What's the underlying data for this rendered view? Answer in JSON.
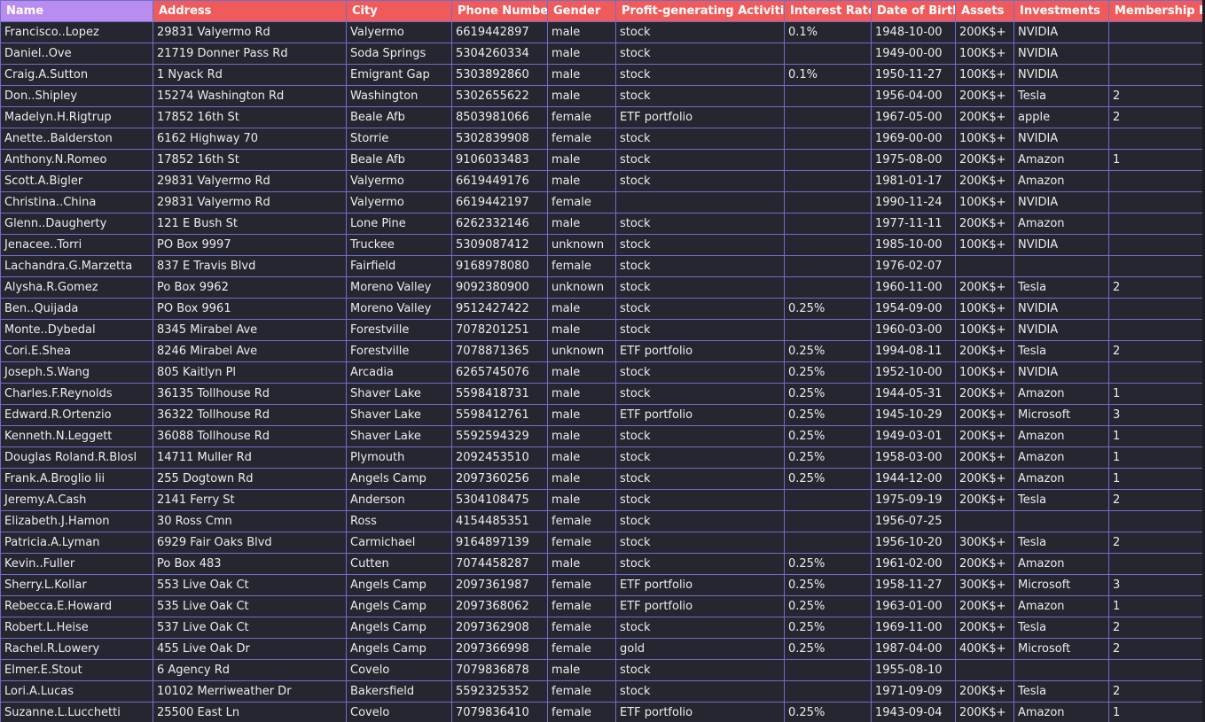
{
  "table": {
    "columns": [
      "Name",
      "Address",
      "City",
      "Phone Number",
      "Gender",
      "Profit-generating Activities",
      "Interest Rate",
      "Date of Birth",
      "Assets",
      "Investments",
      "Membership Pr"
    ],
    "rows": [
      [
        "Francisco..Lopez",
        "29831 Valyermo Rd",
        "Valyermo",
        "6619442897",
        "male",
        "stock",
        "0.1%",
        "1948-10-00",
        "200K$+",
        "NVIDIA",
        ""
      ],
      [
        "Daniel..Ove",
        "21719 Donner Pass Rd",
        "Soda Springs",
        "5304260334",
        "male",
        "stock",
        "",
        "1949-00-00",
        "100K$+",
        "NVIDIA",
        ""
      ],
      [
        "Craig.A.Sutton",
        "1 Nyack Rd",
        "Emigrant Gap",
        "5303892860",
        "male",
        "stock",
        "0.1%",
        "1950-11-27",
        "100K$+",
        "NVIDIA",
        ""
      ],
      [
        "Don..Shipley",
        "15274 Washington Rd",
        "Washington",
        "5302655622",
        "male",
        "stock",
        "",
        "1956-04-00",
        "200K$+",
        "Tesla",
        "2"
      ],
      [
        "Madelyn.H.Rigtrup",
        "17852 16th St",
        "Beale Afb",
        "8503981066",
        "female",
        "ETF portfolio",
        "",
        "1967-05-00",
        "200K$+",
        "apple",
        "2"
      ],
      [
        "Anette..Balderston",
        "6162 Highway 70",
        "Storrie",
        "5302839908",
        "female",
        "stock",
        "",
        "1969-00-00",
        "100K$+",
        "NVIDIA",
        ""
      ],
      [
        "Anthony.N.Romeo",
        "17852 16th St",
        "Beale Afb",
        "9106033483",
        "male",
        "stock",
        "",
        "1975-08-00",
        "200K$+",
        "Amazon",
        "1"
      ],
      [
        "Scott.A.Bigler",
        "29831 Valyermo Rd",
        "Valyermo",
        "6619449176",
        "male",
        "stock",
        "",
        "1981-01-17",
        "200K$+",
        "Amazon",
        ""
      ],
      [
        "Christina..China",
        "29831 Valyermo Rd",
        "Valyermo",
        "6619442197",
        "female",
        "",
        "",
        "1990-11-24",
        "100K$+",
        "NVIDIA",
        ""
      ],
      [
        "Glenn..Daugherty",
        "121 E Bush St",
        "Lone Pine",
        "6262332146",
        "male",
        "stock",
        "",
        "1977-11-11",
        "200K$+",
        "Amazon",
        ""
      ],
      [
        "Jenacee..Torri",
        "PO Box 9997",
        "Truckee",
        "5309087412",
        "unknown",
        "stock",
        "",
        "1985-10-00",
        "100K$+",
        "NVIDIA",
        ""
      ],
      [
        "Lachandra.G.Marzetta",
        "837 E Travis Blvd",
        "Fairfield",
        "9168978080",
        "female",
        "stock",
        "",
        "1976-02-07",
        "",
        "",
        ""
      ],
      [
        "Alysha.R.Gomez",
        "Po Box 9962",
        "Moreno Valley",
        "9092380900",
        "unknown",
        "stock",
        "",
        "1960-11-00",
        "200K$+",
        "Tesla",
        "2"
      ],
      [
        "Ben..Quijada",
        "PO Box 9961",
        "Moreno Valley",
        "9512427422",
        "male",
        "stock",
        "0.25%",
        "1954-09-00",
        "100K$+",
        "NVIDIA",
        ""
      ],
      [
        "Monte..Dybedal",
        "8345 Mirabel Ave",
        "Forestville",
        "7078201251",
        "male",
        "stock",
        "",
        "1960-03-00",
        "100K$+",
        "NVIDIA",
        ""
      ],
      [
        "Cori.E.Shea",
        "8246 Mirabel Ave",
        "Forestville",
        "7078871365",
        "unknown",
        "ETF portfolio",
        "0.25%",
        "1994-08-11",
        "200K$+",
        "Tesla",
        "2"
      ],
      [
        "Joseph.S.Wang",
        "805 Kaitlyn Pl",
        "Arcadia",
        "6265745076",
        "male",
        "stock",
        "0.25%",
        "1952-10-00",
        "100K$+",
        "NVIDIA",
        ""
      ],
      [
        "Charles.F.Reynolds",
        "36135 Tollhouse Rd",
        "Shaver Lake",
        "5598418731",
        "male",
        "stock",
        "0.25%",
        "1944-05-31",
        "200K$+",
        "Amazon",
        "1"
      ],
      [
        "Edward.R.Ortenzio",
        "36322 Tollhouse Rd",
        "Shaver Lake",
        "5598412761",
        "male",
        "ETF portfolio",
        "0.25%",
        "1945-10-29",
        "200K$+",
        "Microsoft",
        "3"
      ],
      [
        "Kenneth.N.Leggett",
        "36088 Tollhouse Rd",
        "Shaver Lake",
        "5592594329",
        "male",
        "stock",
        "0.25%",
        "1949-03-01",
        "200K$+",
        "Amazon",
        "1"
      ],
      [
        "Douglas Roland.R.Blosl",
        "14711 Muller Rd",
        "Plymouth",
        "2092453510",
        "male",
        "stock",
        "0.25%",
        "1958-03-00",
        "200K$+",
        "Amazon",
        "1"
      ],
      [
        "Frank.A.Broglio Iii",
        "255 Dogtown Rd",
        "Angels Camp",
        "2097360256",
        "male",
        "stock",
        "0.25%",
        "1944-12-00",
        "200K$+",
        "Amazon",
        "1"
      ],
      [
        "Jeremy.A.Cash",
        "2141 Ferry St",
        "Anderson",
        "5304108475",
        "male",
        "stock",
        "",
        "1975-09-19",
        "200K$+",
        "Tesla",
        "2"
      ],
      [
        "Elizabeth.J.Hamon",
        "30 Ross Cmn",
        "Ross",
        "4154485351",
        "female",
        "stock",
        "",
        "1956-07-25",
        "",
        "",
        ""
      ],
      [
        "Patricia.A.Lyman",
        "6929 Fair Oaks Blvd",
        "Carmichael",
        "9164897139",
        "female",
        "stock",
        "",
        "1956-10-20",
        "300K$+",
        "Tesla",
        "2"
      ],
      [
        "Kevin..Fuller",
        "Po Box 483",
        "Cutten",
        "7074458287",
        "male",
        "stock",
        "0.25%",
        "1961-02-00",
        "200K$+",
        "Amazon",
        ""
      ],
      [
        "Sherry.L.Kollar",
        "553 Live Oak Ct",
        "Angels Camp",
        "2097361987",
        "female",
        "ETF portfolio",
        "0.25%",
        "1958-11-27",
        "300K$+",
        "Microsoft",
        "3"
      ],
      [
        "Rebecca.E.Howard",
        "535 Live Oak Ct",
        "Angels Camp",
        "2097368062",
        "female",
        "ETF portfolio",
        "0.25%",
        "1963-01-00",
        "200K$+",
        "Amazon",
        "1"
      ],
      [
        "Robert.L.Heise",
        "537 Live Oak Ct",
        "Angels Camp",
        "2097362908",
        "female",
        "stock",
        "0.25%",
        "1969-11-00",
        "200K$+",
        "Tesla",
        "2"
      ],
      [
        "Rachel.R.Lowery",
        "455 Live Oak Dr",
        "Angels Camp",
        "2097366998",
        "female",
        "gold",
        "0.25%",
        "1987-04-00",
        "400K$+",
        "Microsoft",
        "2"
      ],
      [
        "Elmer.E.Stout",
        "6 Agency Rd",
        "Covelo",
        "7079836878",
        "male",
        "stock",
        "",
        "1955-08-10",
        "",
        "",
        ""
      ],
      [
        "Lori.A.Lucas",
        "10102 Merriweather Dr",
        "Bakersfield",
        "5592325352",
        "female",
        "stock",
        "",
        "1971-09-09",
        "200K$+",
        "Tesla",
        "2"
      ],
      [
        "Suzanne.L.Lucchetti",
        "25500 East Ln",
        "Covelo",
        "7079836410",
        "female",
        "ETF portfolio",
        "0.25%",
        "1943-09-04",
        "200K$+",
        "Amazon",
        "1"
      ]
    ]
  }
}
